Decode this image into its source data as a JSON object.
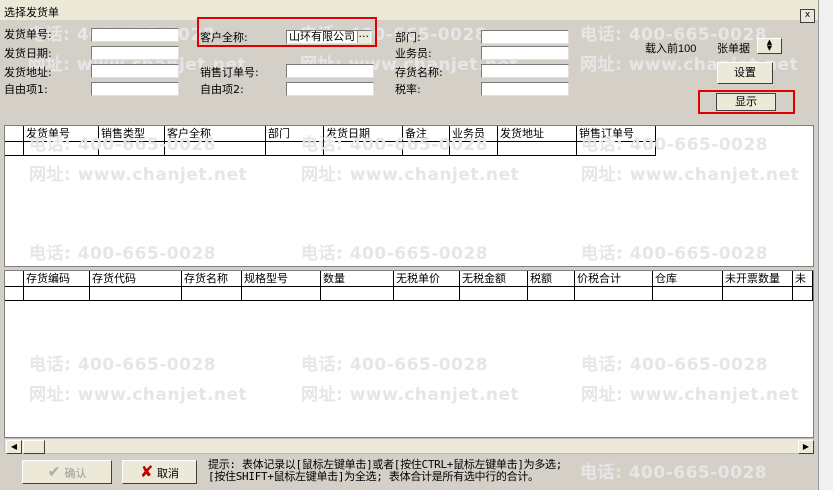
{
  "window": {
    "title": "选择发货单",
    "close": "x"
  },
  "form": {
    "labels": {
      "delivery_no": "发货单号:",
      "delivery_date": "发货日期:",
      "delivery_addr": "发货地址:",
      "custom1": "自由项1:",
      "customer_name": "客户全称:",
      "sales_order_no": "销售订单号:",
      "custom2": "自由项2:",
      "department": "部门:",
      "salesman": "业务员:",
      "inventory_name": "存货名称:",
      "tax_rate": "税率:"
    },
    "customer_value": "山环有限公司",
    "ellipsis": "···"
  },
  "load": {
    "prefix": "载入前",
    "count": "100",
    "suffix": "张单据"
  },
  "buttons": {
    "settings": "设置",
    "show": "显示",
    "confirm": "确认",
    "cancel": "取消"
  },
  "table1": {
    "columns": [
      "",
      "发货单号",
      "销售类型",
      "客户全称",
      "部门",
      "发货日期",
      "备注",
      "业务员",
      "发货地址",
      "销售订单号"
    ]
  },
  "table2": {
    "columns": [
      "",
      "存货编码",
      "存货代码",
      "存货名称",
      "规格型号",
      "数量",
      "无税单价",
      "无税金额",
      "税额",
      "价税合计",
      "仓库",
      "未开票数量",
      "未"
    ]
  },
  "watermark": {
    "phone": "电话: 400-665-0028",
    "site": "网址: www.chanjet.net"
  },
  "hint": {
    "line1": "提示: 表体记录以[鼠标左键单击]或者[按住CTRL+鼠标左键单击]为多选;",
    "line2": "[按住SHIFT+鼠标左键单击]为全选; 表体合计是所有选中行的合计。"
  },
  "icons": {
    "confirm": "check-icon",
    "cancel": "x-icon",
    "scroll_left": "arrow-left-icon",
    "scroll_right": "arrow-right-icon"
  },
  "colors": {
    "highlight": "#e00000",
    "background": "#d4d0c8",
    "watermark": "#e6e6e6"
  }
}
